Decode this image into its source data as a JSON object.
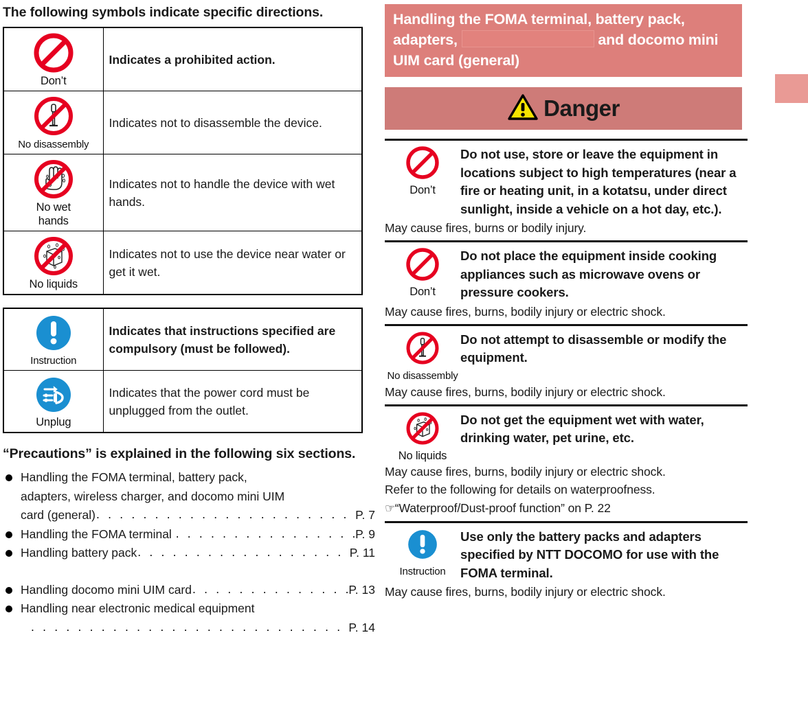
{
  "left": {
    "heading": "The following symbols indicate specific directions.",
    "symbol_table_1": [
      {
        "icon": "prohibition-icon",
        "label": "Don’t",
        "label_lines": [
          "Don’t"
        ],
        "description": "Indicates a prohibited action.",
        "bold": true
      },
      {
        "icon": "no-disassembly-icon",
        "label": "No disassembly",
        "label_lines": [
          "No disassembly"
        ],
        "description": "Indicates not to disassemble the device.",
        "bold": false
      },
      {
        "icon": "no-wet-hands-icon",
        "label": "No wet hands",
        "label_lines": [
          "No wet",
          "hands"
        ],
        "description": "Indicates not to handle the device with wet hands.",
        "bold": false
      },
      {
        "icon": "no-liquids-icon",
        "label": "No liquids",
        "label_lines": [
          "No liquids"
        ],
        "description": "Indicates not to use the device near water or get it wet.",
        "bold": false
      }
    ],
    "symbol_table_2": [
      {
        "icon": "instruction-icon",
        "label": "Instruction",
        "label_lines": [
          "Instruction"
        ],
        "description": "Indicates that instructions specified are compulsory (must be followed).",
        "bold": true
      },
      {
        "icon": "unplug-icon",
        "label": "Unplug",
        "label_lines": [
          "Unplug"
        ],
        "description": "Indicates that the power cord must be unplugged from the outlet.",
        "bold": false
      }
    ],
    "toc_heading": "“Precautions” is explained in the following six sections.",
    "toc": [
      {
        "text_lines": [
          "Handling the FOMA terminal, battery pack,",
          "adapters, wireless charger, and docomo mini UIM",
          "card (general)"
        ],
        "page": "P. 7"
      },
      {
        "text_lines": [
          "Handling the FOMA terminal "
        ],
        "page": "P. 9"
      },
      {
        "text_lines": [
          "Handling battery pack"
        ],
        "page": "P. 11"
      },
      {
        "text_lines": [
          "Handling docomo mini UIM card"
        ],
        "page": "P. 13"
      },
      {
        "text_lines": [
          "Handling near electronic medical equipment",
          ""
        ],
        "page": "P. 14"
      }
    ]
  },
  "right": {
    "section_title_part1": "Handling the FOMA terminal, battery pack, adapters,",
    "section_title_part2": "and docomo mini UIM card (general)",
    "section_title_full": "Handling the FOMA terminal, battery pack, adapters, [redacted] and docomo mini UIM card (general)",
    "danger_label": "Danger",
    "danger_icon": "warning-triangle-icon",
    "warnings": [
      {
        "icon": "prohibition-icon",
        "icon_label": "Don’t",
        "title": "Do not use, store or leave the equipment in locations subject to high temperatures (near a fire or heating unit, in a kotatsu, under direct sunlight, inside a vehicle on a hot day, etc.).",
        "notes": [
          "May cause fires, burns or bodily injury."
        ]
      },
      {
        "icon": "prohibition-icon",
        "icon_label": "Don’t",
        "title": "Do not place the equipment inside cooking appliances such as microwave ovens or pressure cookers.",
        "notes": [
          "May cause fires, burns, bodily injury or electric shock."
        ]
      },
      {
        "icon": "no-disassembly-icon",
        "icon_label": "No disassembly",
        "title": "Do not attempt to disassemble or modify the equipment.",
        "notes": [
          "May cause fires, burns, bodily injury or electric shock."
        ]
      },
      {
        "icon": "no-liquids-icon",
        "icon_label": "No liquids",
        "title": "Do not get the equipment wet with water, drinking water, pet urine, etc.",
        "notes": [
          "May cause fires, burns, bodily injury or electric shock.",
          "Refer to the following for details on waterproofness.",
          "“Waterproof/Dust-proof function” on P. 22"
        ],
        "has_pointer_on_last_note": true
      },
      {
        "icon": "instruction-icon",
        "icon_label": "Instruction",
        "title": "Use only the battery packs and adapters specified by NTT DOCOMO for use with the FOMA terminal.",
        "notes": [
          "May cause fires, burns, bodily injury or electric shock."
        ]
      }
    ]
  },
  "colors": {
    "section_header_bg": "#dd7f7b",
    "danger_banner_bg": "#ce7b78",
    "redaction_box": "#e2827d",
    "edge_tab": "#e99a95",
    "prohibition_red": "#e60020",
    "instruction_blue": "#1a8fd1",
    "danger_triangle_yellow": "#f5e300",
    "text_black": "#1a1a1a"
  }
}
